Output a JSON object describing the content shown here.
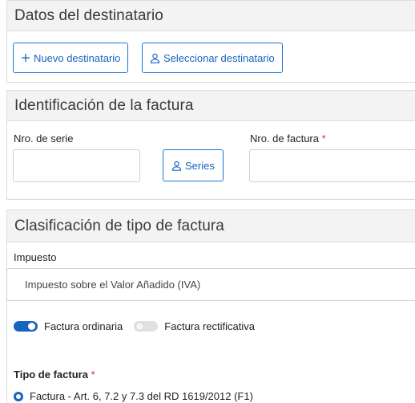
{
  "recipient": {
    "title": "Datos del destinatario",
    "new_button": "Nuevo destinatario",
    "select_button": "Seleccionar destinatario"
  },
  "invoice_id": {
    "title": "Identificación de la factura",
    "series_label": "Nro. de serie",
    "series_value": "",
    "series_button": "Series",
    "invoice_number_label": "Nro. de factura",
    "invoice_number_value": "",
    "required_mark": "*"
  },
  "classification": {
    "title": "Clasificación de tipo de factura",
    "tax_label": "Impuesto",
    "tax_selected": "Impuesto sobre el Valor Añadido (IVA)",
    "toggles": [
      {
        "label": "Factura ordinaria",
        "state": "on"
      },
      {
        "label": "Factura rectificativa",
        "state": "off"
      }
    ],
    "type_label": "Tipo de factura",
    "required_mark": "*",
    "type_option": "Factura - Art. 6, 7.2 y 7.3 del RD 1619/2012 (F1)"
  },
  "colors": {
    "accent": "#1565c0",
    "required": "#d32f2f",
    "header_bg": "#f3f3f3"
  }
}
